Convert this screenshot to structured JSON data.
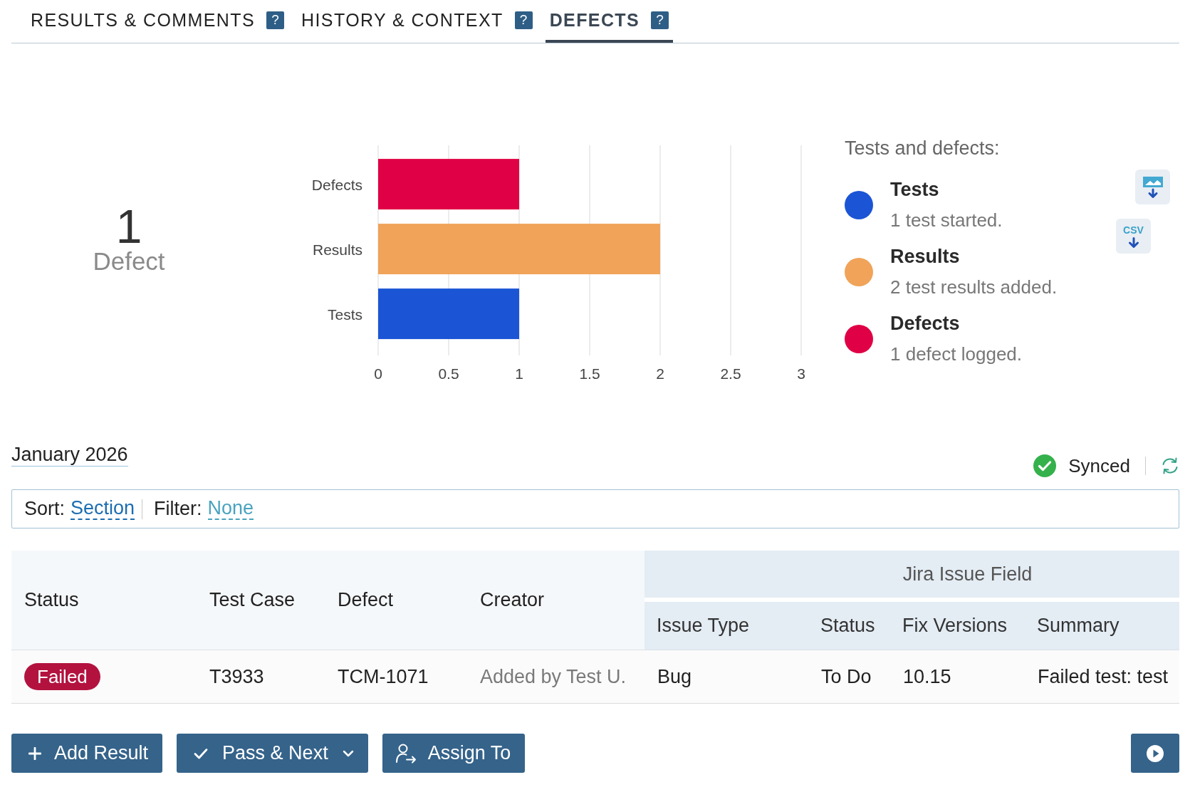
{
  "tabs": [
    {
      "label": "RESULTS & COMMENTS",
      "help": "?",
      "selected": false
    },
    {
      "label": "HISTORY & CONTEXT",
      "help": "?",
      "selected": false
    },
    {
      "label": "DEFECTS",
      "help": "?",
      "selected": true
    }
  ],
  "summary": {
    "count": "1",
    "label": "Defect"
  },
  "chart": {
    "chart_data": {
      "type": "bar",
      "orientation": "horizontal",
      "categories": [
        "Defects",
        "Results",
        "Tests"
      ],
      "series": [
        {
          "values": [
            1,
            2,
            1
          ]
        }
      ],
      "xlim": [
        0,
        3
      ],
      "xticks": [
        0,
        0.5,
        1,
        1.5,
        2,
        2.5,
        3
      ],
      "grid": true
    }
  },
  "legend": {
    "title": "Tests and defects:",
    "items": [
      {
        "name": "Tests",
        "description": "1 test started.",
        "color": "#1b55d5"
      },
      {
        "name": "Results",
        "description": "2 test results added.",
        "color": "#f0a359"
      },
      {
        "name": "Defects",
        "description": "1 defect logged.",
        "color": "#e00045"
      }
    ]
  },
  "exports": [
    {
      "kind": "image"
    },
    {
      "kind": "csv",
      "label": "CSV"
    }
  ],
  "period": "January 2026",
  "sync": {
    "label": "Synced"
  },
  "sort_bar": {
    "sort_label": "Sort:",
    "sort_value": "Section",
    "filter_label": "Filter:",
    "filter_value": "None"
  },
  "table": {
    "columns": [
      {
        "label": "Status",
        "kind": "status"
      },
      {
        "label": "Test Case",
        "kind": "text"
      },
      {
        "label": "Defect",
        "kind": "text"
      },
      {
        "label": "Creator",
        "kind": "muted"
      }
    ],
    "group": {
      "label": "Jira Issue Field",
      "columns": [
        {
          "label": "Issue Type",
          "kind": "text"
        },
        {
          "label": "Status",
          "kind": "text"
        },
        {
          "label": "Fix Versions",
          "kind": "text"
        },
        {
          "label": "Summary",
          "kind": "text"
        }
      ]
    },
    "rows": [
      {
        "cells": [
          "Failed",
          "T3933",
          "TCM-1071",
          "Added by Test U.",
          "Bug",
          "To Do",
          "10.15",
          "Failed test: test"
        ]
      }
    ]
  },
  "actions": [
    {
      "kind": "add",
      "label": "Add Result"
    },
    {
      "kind": "pass",
      "label": "Pass & Next"
    },
    {
      "kind": "assign",
      "label": "Assign To"
    },
    {
      "kind": "play"
    }
  ]
}
